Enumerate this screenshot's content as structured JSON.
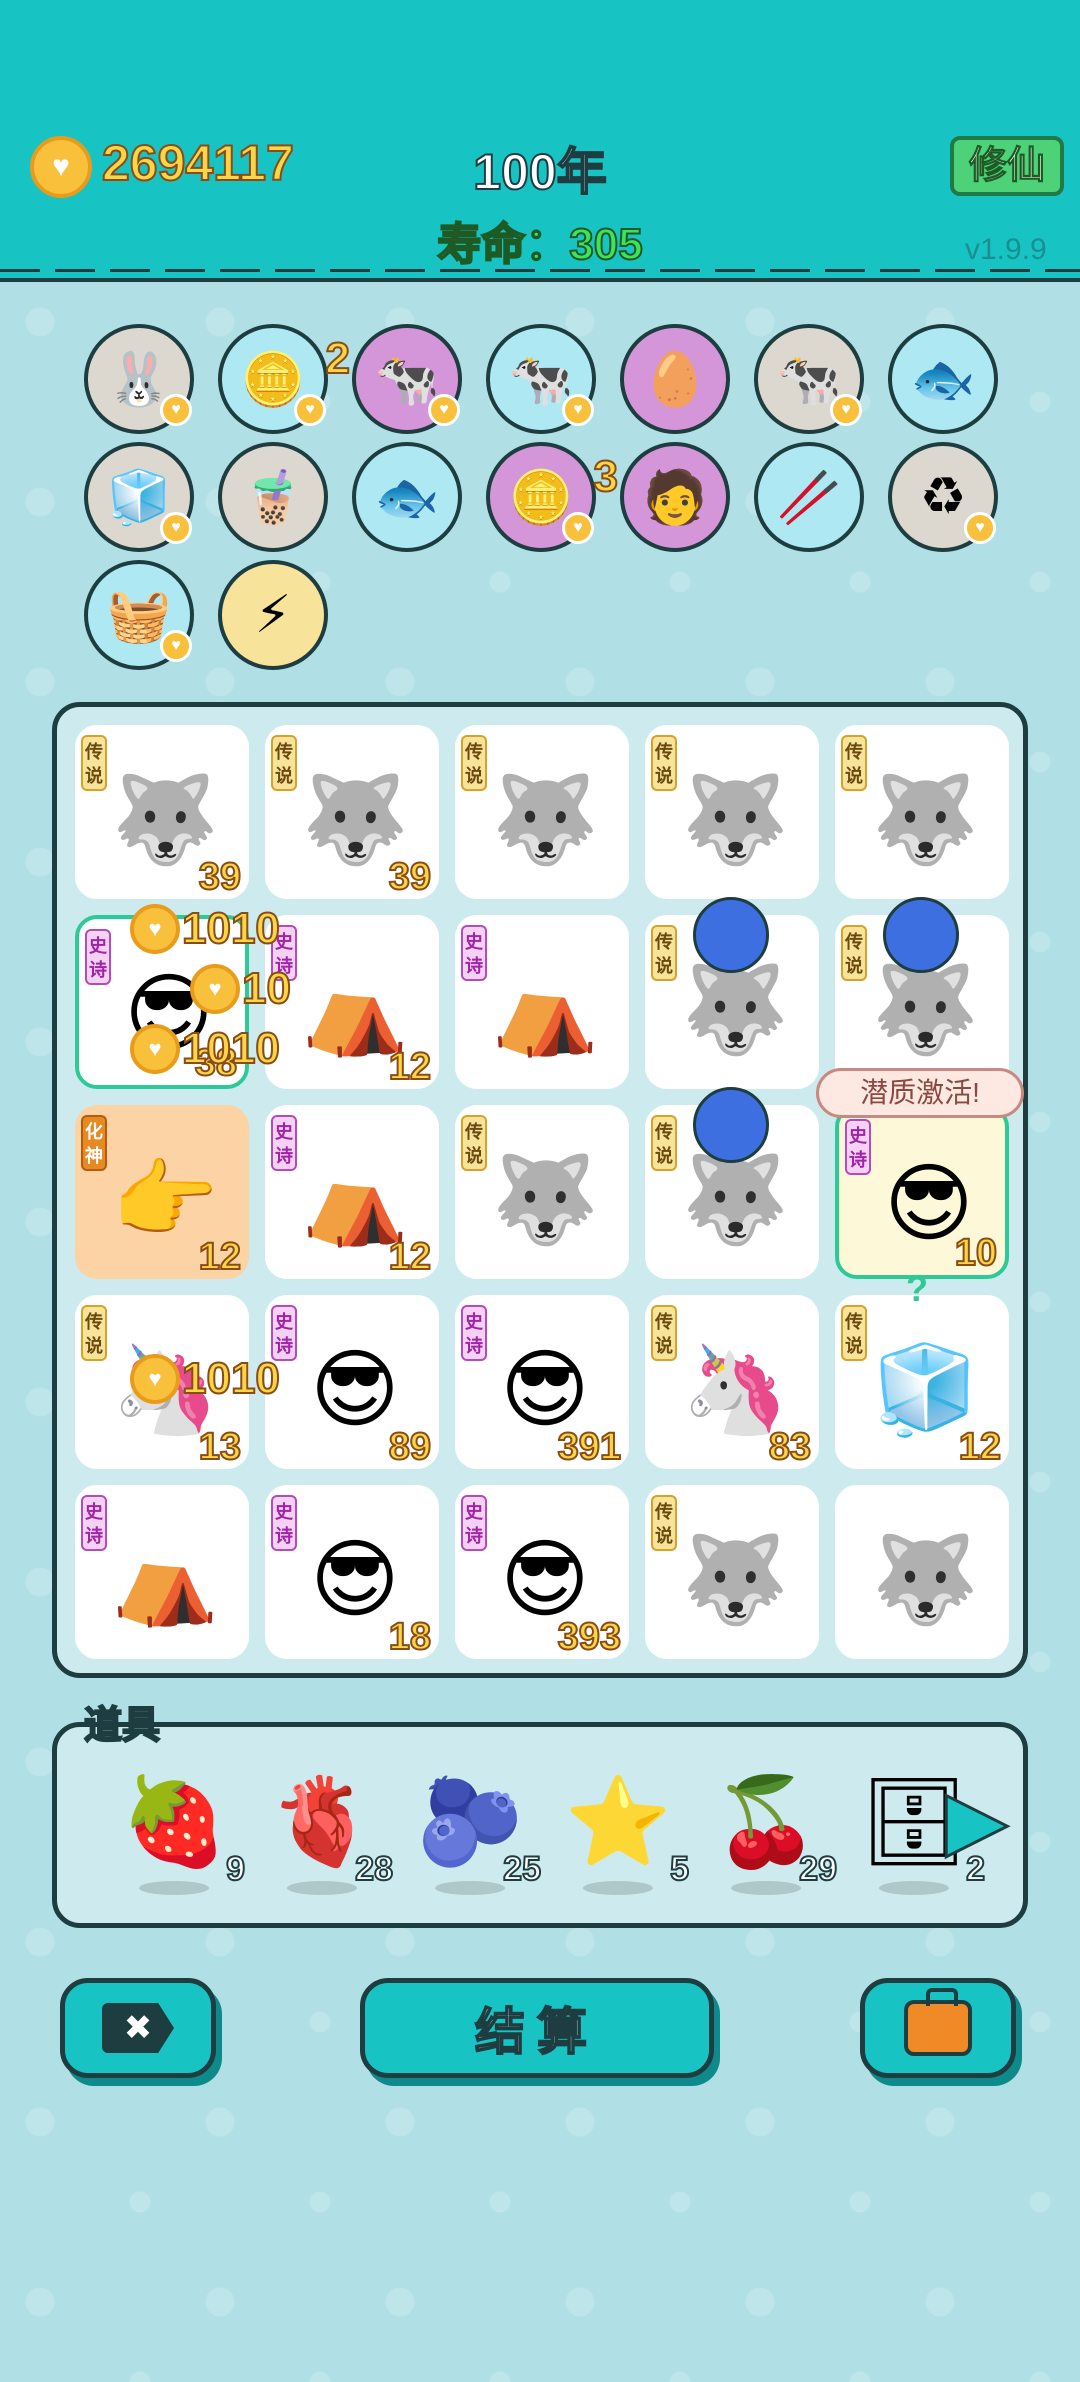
{
  "header": {
    "coins": "2694117",
    "year": "100年",
    "lifespan": "寿命：305",
    "xiuxian_label": "修仙",
    "version": "v1.9.9"
  },
  "relics": {
    "row1": [
      {
        "name": "rabbit-icon",
        "bg": "gray"
      },
      {
        "name": "coin-seed-icon",
        "bg": "blue",
        "count": "2"
      },
      {
        "name": "cows-icon",
        "bg": "purple"
      },
      {
        "name": "cows-icon",
        "bg": "blue"
      },
      {
        "name": "egg-glasses-icon",
        "bg": "purple"
      },
      {
        "name": "cows-icon",
        "bg": "gray"
      },
      {
        "name": "fishbowl-icon",
        "bg": "blue"
      }
    ],
    "row2": [
      {
        "name": "sugar-cubes-icon",
        "bg": "gray"
      },
      {
        "name": "bubble-tea-icon",
        "bg": "gray"
      },
      {
        "name": "fishbowl-icon",
        "bg": "blue"
      },
      {
        "name": "coin-seed-icon",
        "bg": "purple",
        "count": "3"
      },
      {
        "name": "multiplier-man-icon",
        "bg": "purple"
      },
      {
        "name": "crossed-sticks-icon",
        "bg": "blue"
      },
      {
        "name": "refresh-icon",
        "bg": "gray"
      }
    ],
    "row3": [
      {
        "name": "fruit-basket-icon",
        "bg": "blue"
      },
      {
        "name": "lightning-icon",
        "bg": "yellow"
      }
    ]
  },
  "board": {
    "tags": {
      "legend": "传说",
      "epic": "史诗",
      "god": "化神"
    },
    "cells": [
      {
        "fig": "husky-king",
        "tag": "legend",
        "num": "39"
      },
      {
        "fig": "husky-king",
        "tag": "legend",
        "num": "39"
      },
      {
        "fig": "husky-king",
        "tag": "legend",
        "num": ""
      },
      {
        "fig": "husky-king",
        "tag": "legend",
        "num": ""
      },
      {
        "fig": "husky-king",
        "tag": "legend",
        "num": ""
      },
      {
        "fig": "green-hat-man",
        "tag": "epic",
        "num": "38"
      },
      {
        "fig": "rabbit-tent",
        "tag": "epic",
        "num": "12"
      },
      {
        "fig": "rabbit-tent",
        "tag": "epic",
        "num": ""
      },
      {
        "fig": "husky-blueberry",
        "tag": "legend",
        "num": ""
      },
      {
        "fig": "husky-blueberry",
        "tag": "legend",
        "num": ""
      },
      {
        "fig": "pointing-hand",
        "tag": "god",
        "num": "12"
      },
      {
        "fig": "rabbit-tent",
        "tag": "epic",
        "num": "12"
      },
      {
        "fig": "husky-king",
        "tag": "legend",
        "num": ""
      },
      {
        "fig": "husky-blueberry",
        "tag": "legend",
        "num": ""
      },
      {
        "fig": "green-hat-man",
        "tag": "epic",
        "num": "10"
      },
      {
        "fig": "unicorn",
        "tag": "legend",
        "num": "13"
      },
      {
        "fig": "green-hat-man",
        "tag": "epic",
        "num": "89"
      },
      {
        "fig": "green-hat-man",
        "tag": "epic",
        "num": "391"
      },
      {
        "fig": "unicorn",
        "tag": "legend",
        "num": "83"
      },
      {
        "fig": "fridge",
        "tag": "legend",
        "num": "12"
      },
      {
        "fig": "rabbit-tent",
        "tag": "epic",
        "num": ""
      },
      {
        "fig": "green-hat-man",
        "tag": "epic",
        "num": "18"
      },
      {
        "fig": "green-hat-man",
        "tag": "epic",
        "num": "393"
      },
      {
        "fig": "husky-king",
        "tag": "legend",
        "num": ""
      },
      {
        "fig": "husky-king",
        "tag": "",
        "num": ""
      }
    ],
    "floating": [
      "1010",
      "10",
      "1010",
      "1010"
    ],
    "bubble": "潜质激活!",
    "qmark": "?"
  },
  "props": {
    "title": "道具",
    "items": [
      {
        "name": "strawberry-icon",
        "count": "9"
      },
      {
        "name": "liver-icon",
        "count": "28"
      },
      {
        "name": "blueberry-icon",
        "count": "25"
      },
      {
        "name": "star-icon",
        "count": "5"
      },
      {
        "name": "lychee-icon",
        "count": "29"
      },
      {
        "name": "cabinet-icon",
        "count": "2"
      }
    ]
  },
  "buttons": {
    "settle": "结算",
    "close_glyph": "✖"
  },
  "colors": {
    "teal": "#18c3c4",
    "coin_yellow": "#f9d547",
    "green_text": "#3ee35a"
  }
}
